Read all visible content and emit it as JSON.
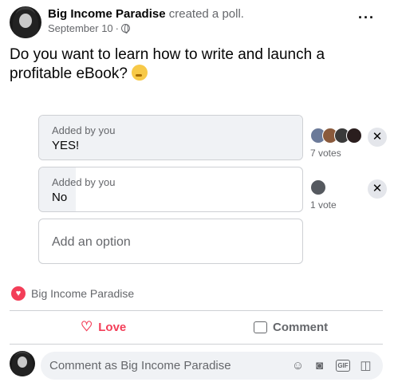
{
  "post": {
    "author": "Big Income Paradise",
    "action": " created a poll.",
    "date": "September 10",
    "separator": " · ",
    "more_label": "···",
    "question": "Do you want to learn how to write and launch a profitable eBook? "
  },
  "poll": {
    "options": [
      {
        "added_by": "Added by you",
        "label": "YES!",
        "votes_text": "7 votes",
        "vote_share": 1.0
      },
      {
        "added_by": "Added by you",
        "label": "No",
        "votes_text": "1 vote",
        "vote_share": 0.14
      }
    ],
    "add_option_placeholder": "Add an option",
    "remove_label": "✕"
  },
  "reactions": {
    "summary": "Big Income Paradise",
    "icon": "love-icon"
  },
  "actions": {
    "love_label": "Love",
    "comment_label": "Comment"
  },
  "comment": {
    "placeholder": "Comment as Big Income Paradise"
  },
  "colors": {
    "accent_love": "#f33e58",
    "muted_text": "#65676b",
    "fill": "#f0f2f5"
  }
}
